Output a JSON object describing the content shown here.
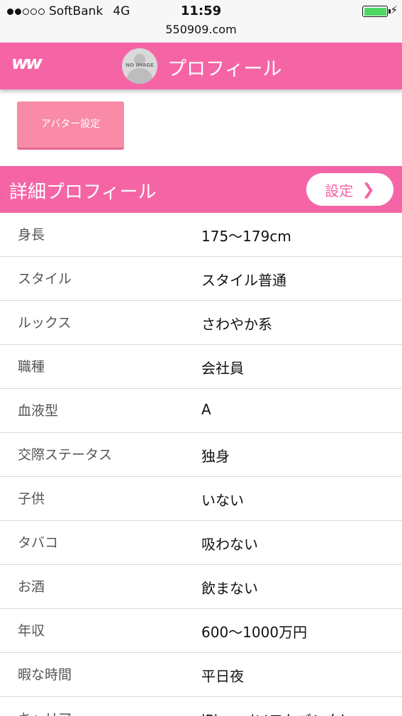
{
  "status_bar": {
    "signal_dots_on": 2,
    "signal_dots_total": 5,
    "carrier": "SoftBank",
    "network": "4G",
    "time": "11:59",
    "battery_level": 1.0
  },
  "url_bar": {
    "url": "550909.com"
  },
  "header": {
    "logo_text": "ww",
    "avatar_text": "NO IMAGE",
    "title": "プロフィール"
  },
  "avatar_button": {
    "label": "アバター設定"
  },
  "detail": {
    "title": "詳細プロフィール",
    "setting_label": "設定",
    "rows": [
      {
        "label": "身長",
        "value": "175〜179cm"
      },
      {
        "label": "スタイル",
        "value": "スタイル普通"
      },
      {
        "label": "ルックス",
        "value": "さわやか系"
      },
      {
        "label": "職種",
        "value": "会社員"
      },
      {
        "label": "血液型",
        "value": "A"
      },
      {
        "label": "交際ステータス",
        "value": "独身"
      },
      {
        "label": "子供",
        "value": "いない"
      },
      {
        "label": "タバコ",
        "value": "吸わない"
      },
      {
        "label": "お酒",
        "value": "飲まない"
      },
      {
        "label": "年収",
        "value": "600〜1000万円"
      },
      {
        "label": "暇な時間",
        "value": "平日夜"
      },
      {
        "label": "キャリア",
        "value": "iPhone(ソフトバンク)"
      }
    ]
  },
  "colors": {
    "accent": "#f565a6",
    "button": "#f98aa8",
    "battery": "#4cd964"
  }
}
